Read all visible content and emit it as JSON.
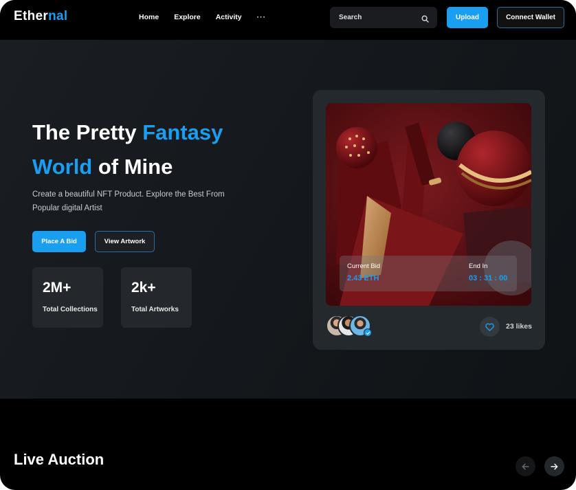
{
  "brand": {
    "name_part1": "Ether",
    "name_part2": "nal"
  },
  "nav": {
    "items": [
      "Home",
      "Explore",
      "Activity"
    ],
    "more": "···"
  },
  "search": {
    "placeholder": "Search"
  },
  "header_buttons": {
    "upload": "Upload",
    "connect_wallet": "Connect Wallet"
  },
  "hero": {
    "headline_1": "The Pretty ",
    "headline_1_highlight": "Fantasy",
    "headline_2_highlight": "World",
    "headline_2": " of Mine",
    "subtext": "Create a beautiful NFT Product. Explore the Best From Popular digital Artist",
    "primary_button": "Place A Bid",
    "secondary_button": "View Artwork",
    "stats": [
      {
        "value": "2M+",
        "label": "Total Collections"
      },
      {
        "value": "2k+",
        "label": "Total Artworks"
      }
    ]
  },
  "nft_card": {
    "current_bid_label": "Current Bid",
    "current_bid_value": "2.43 ETH",
    "end_in_label": "End In",
    "end_in_value": "03 : 31 : 00",
    "likes": "23 likes"
  },
  "live_auction": {
    "title": "Live Auction"
  },
  "colors": {
    "accent": "#1a9ff0",
    "background": "#000000",
    "card": "#24292d"
  },
  "icons": [
    "search-icon",
    "heart-icon",
    "arrow-left-icon",
    "arrow-right-icon",
    "verified-icon"
  ]
}
